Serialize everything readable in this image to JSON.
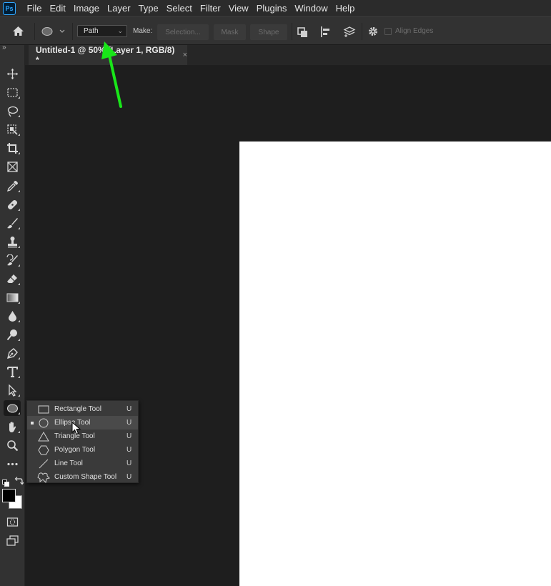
{
  "app": {
    "logo": "Ps"
  },
  "menu": [
    "File",
    "Edit",
    "Image",
    "Layer",
    "Type",
    "Select",
    "Filter",
    "View",
    "Plugins",
    "Window",
    "Help"
  ],
  "options_bar": {
    "mode_value": "Path",
    "make_label": "Make:",
    "selection_button": "Selection...",
    "mask_button": "Mask",
    "shape_button": "Shape",
    "align_edges_label": "Align Edges",
    "align_edges_checked": false
  },
  "collapse_glyph": "››",
  "document_tab": {
    "title": "Untitled-1 @ 50% (Layer 1, RGB/8) *",
    "close_glyph": "×"
  },
  "tools": [
    "move-tool-icon",
    "marquee-tool-icon",
    "lasso-tool-icon",
    "object-selection-tool-icon",
    "crop-tool-icon",
    "frame-tool-icon",
    "eyedropper-tool-icon",
    "spot-healing-tool-icon",
    "brush-tool-icon",
    "clone-stamp-tool-icon",
    "history-brush-tool-icon",
    "eraser-tool-icon",
    "gradient-tool-icon",
    "blur-tool-icon",
    "dodge-tool-icon",
    "pen-tool-icon",
    "type-tool-icon",
    "path-selection-tool-icon",
    "ellipse-tool-icon",
    "hand-tool-icon",
    "zoom-tool-icon",
    "more-tools-icon"
  ],
  "flyout": {
    "items": [
      {
        "label": "Rectangle Tool",
        "key": "U",
        "icon": "rectangle-icon"
      },
      {
        "label": "Ellipse Tool",
        "key": "U",
        "icon": "ellipse-icon",
        "selected": true
      },
      {
        "label": "Triangle Tool",
        "key": "U",
        "icon": "triangle-icon"
      },
      {
        "label": "Polygon Tool",
        "key": "U",
        "icon": "polygon-icon"
      },
      {
        "label": "Line Tool",
        "key": "U",
        "icon": "line-icon"
      },
      {
        "label": "Custom Shape Tool",
        "key": "U",
        "icon": "custom-shape-icon"
      }
    ]
  },
  "colors": {
    "annotation_arrow": "#19e619",
    "foreground": "#000000",
    "background": "#ffffff"
  }
}
